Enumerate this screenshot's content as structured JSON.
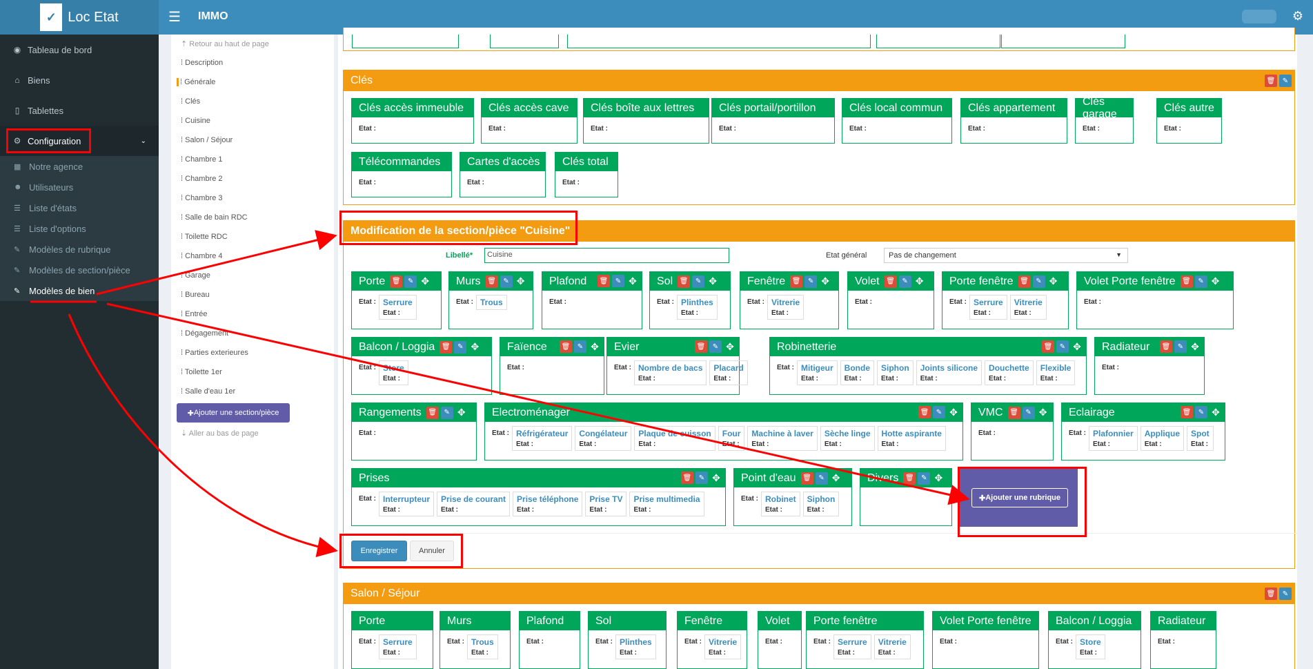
{
  "app": {
    "name": "Loc Etat",
    "section": "IMMO"
  },
  "sidebar": {
    "items": [
      {
        "label": "Tableau de bord",
        "icon": "dashboard-icon"
      },
      {
        "label": "Biens",
        "icon": "home-icon"
      },
      {
        "label": "Tablettes",
        "icon": "tablet-icon"
      },
      {
        "label": "Configuration",
        "icon": "cogs-icon"
      }
    ],
    "submenu": [
      {
        "label": "Notre agence",
        "icon": "building-icon"
      },
      {
        "label": "Utilisateurs",
        "icon": "users-icon"
      },
      {
        "label": "Liste d'états",
        "icon": "list-icon"
      },
      {
        "label": "Liste d'options",
        "icon": "list-icon"
      },
      {
        "label": "Modèles de rubrique",
        "icon": "wrench-icon"
      },
      {
        "label": "Modèles de section/pièce",
        "icon": "wrench-icon"
      },
      {
        "label": "Modèles de bien",
        "icon": "wrench-icon"
      }
    ]
  },
  "nav": {
    "top_link": "Retour au haut de page",
    "sections": [
      "Description",
      "Générale",
      "Clés",
      "Cuisine",
      "Salon / Séjour",
      "Chambre 1",
      "Chambre 2",
      "Chambre 3",
      "Salle de bain RDC",
      "Toilette RDC",
      "Chambre 4",
      "Garage",
      "Bureau",
      "Entrée",
      "Dégagement",
      "Parties exterieures",
      "Toilette 1er",
      "Salle d'eau 1er"
    ],
    "add_button": "Ajouter une section/pièce",
    "bottom_link": "Aller au bas de page"
  },
  "etat": "Etat :",
  "cles": {
    "title": "Clés",
    "items": [
      "Clés accès immeuble",
      "Clés accès cave",
      "Clés boîte aux lettres",
      "Clés portail/portillon",
      "Clés local commun",
      "Clés appartement",
      "Clés garage",
      "Clés autre",
      "Télécommandes",
      "Cartes d'accès",
      "Clés total"
    ]
  },
  "cuisine": {
    "title": "Modification de la section/pièce \"Cuisine\"",
    "libelle_label": "Libellé*",
    "libelle_value": "Cuisine",
    "etat_general_label": "Etat général",
    "etat_general_value": "Pas de changement",
    "rubriques": [
      {
        "name": "Porte",
        "subs": [
          "Serrure"
        ]
      },
      {
        "name": "Murs",
        "subs": [
          "Trous"
        ]
      },
      {
        "name": "Plafond",
        "subs": []
      },
      {
        "name": "Sol",
        "subs": [
          "Plinthes"
        ]
      },
      {
        "name": "Fenêtre",
        "subs": [
          "Vitrerie"
        ]
      },
      {
        "name": "Volet",
        "subs": []
      },
      {
        "name": "Porte fenêtre",
        "subs": [
          "Serrure",
          "Vitrerie"
        ]
      },
      {
        "name": "Volet Porte fenêtre",
        "subs": []
      },
      {
        "name": "Balcon / Loggia",
        "subs": [
          "Store"
        ]
      },
      {
        "name": "Faïence",
        "subs": []
      },
      {
        "name": "Evier",
        "subs": [
          "Nombre de bacs",
          "Placard"
        ]
      },
      {
        "name": "Robinetterie",
        "subs": [
          "Mitigeur",
          "Bonde",
          "Siphon",
          "Joints silicone",
          "Douchette",
          "Flexible"
        ]
      },
      {
        "name": "Radiateur",
        "subs": []
      },
      {
        "name": "Rangements",
        "subs": []
      },
      {
        "name": "Electroménager",
        "subs": [
          "Réfrigérateur",
          "Congélateur",
          "Plaque de cuisson",
          "Four",
          "Machine à laver",
          "Sèche linge",
          "Hotte aspirante"
        ]
      },
      {
        "name": "VMC",
        "subs": []
      },
      {
        "name": "Eclairage",
        "subs": [
          "Plafonnier",
          "Applique",
          "Spot"
        ]
      },
      {
        "name": "Prises",
        "subs": [
          "Interrupteur",
          "Prise de courant",
          "Prise téléphone",
          "Prise TV",
          "Prise multimedia"
        ]
      },
      {
        "name": "Point d'eau",
        "subs": [
          "Robinet",
          "Siphon"
        ]
      },
      {
        "name": "Divers",
        "subs": []
      }
    ],
    "add_rubrique": "Ajouter une rubrique",
    "save": "Enregistrer",
    "cancel": "Annuler"
  },
  "salon": {
    "title": "Salon / Séjour",
    "rubriques": [
      {
        "name": "Porte",
        "subs": [
          "Serrure"
        ]
      },
      {
        "name": "Murs",
        "subs": [
          "Trous"
        ]
      },
      {
        "name": "Plafond",
        "subs": []
      },
      {
        "name": "Sol",
        "subs": [
          "Plinthes"
        ]
      },
      {
        "name": "Fenêtre",
        "subs": [
          "Vitrerie"
        ]
      },
      {
        "name": "Volet",
        "subs": []
      },
      {
        "name": "Porte fenêtre",
        "subs": [
          "Serrure",
          "Vitrerie"
        ]
      },
      {
        "name": "Volet Porte fenêtre",
        "subs": []
      },
      {
        "name": "Balcon / Loggia",
        "subs": [
          "Store"
        ]
      },
      {
        "name": "Radiateur",
        "subs": []
      }
    ]
  },
  "colors": {
    "header": "#3c8dbc",
    "sidebar": "#222d32",
    "orange": "#f39c12",
    "green": "#00a65a",
    "purple": "#605ca8",
    "annotation": "#ff0000"
  }
}
